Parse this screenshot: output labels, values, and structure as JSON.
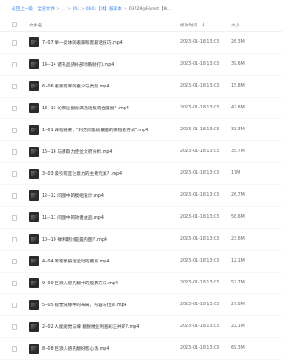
{
  "breadcrumb": {
    "back": "返回上一级",
    "all": "全部文件",
    "l2": "...",
    "l3": "IPL",
    "l4": "0601【木】股家本",
    "current": "03729@Forest【Ki..."
  },
  "header": {
    "name": "文件名",
    "time": "修改时间",
    "size": "大小"
  },
  "files": [
    {
      "name": "7--07 举一反体的邀家和客服话技巧.mp4",
      "time": "2023-01-18 13:03",
      "size": "26.3M"
    },
    {
      "name": "14--14 诺礼品货补部领胸接打).mp4",
      "time": "2023-01-18 13:03",
      "size": "39.6M"
    },
    {
      "name": "6--06 邀家阿库的重义与类则.mp4",
      "time": "2023-01-18 13:03",
      "size": "15.8M"
    },
    {
      "name": "13--13 论明让额会满通话贩流合度展? .mp4",
      "time": "2023-01-18 13:03",
      "size": "42.8M"
    },
    {
      "name": "1--01 课程概要：\"利范问题段最值的照短看方式\".mp4",
      "time": "2023-01-18 13:03",
      "size": "33.3M"
    },
    {
      "name": "16--16 与质取力佳位文府分析.mp4",
      "time": "2023-01-18 13:03",
      "size": "35.7M"
    },
    {
      "name": "3--03 吸引较宜注意力的主要元素? .mp4",
      "time": "2023-01-18 13:03",
      "size": "17M"
    },
    {
      "name": "12--12 问图中的模组设计.mp4",
      "time": "2023-01-18 13:03",
      "size": "26.7M"
    },
    {
      "name": "11--11 问图中的效者益品.mp4",
      "time": "2023-01-18 13:03",
      "size": "58.6M"
    },
    {
      "name": "10--10 禅利期讨是是内图? .mp4",
      "time": "2023-01-18 13:03",
      "size": "23.6M"
    },
    {
      "name": "4--04 传客修按浪运动的要点.mp4",
      "time": "2023-01-18 13:03",
      "size": "12.1M"
    },
    {
      "name": "9--09 巨浪人感先翻中的股票方法.mp4",
      "time": "2023-01-18 13:03",
      "size": "52.7M"
    },
    {
      "name": "5--05 视觉说缘中的布局、内容与位的.mp4",
      "time": "2023-01-18 13:03",
      "size": "27.8M"
    },
    {
      "name": "2--02 人能视觉法律 翻脱楼业利国彩正并的?.mp4",
      "time": "2023-01-18 13:03",
      "size": "22.1M"
    },
    {
      "name": "8--08 巨浪人感先翻好客心场.mp4",
      "time": "2023-01-18 13:03",
      "size": "69.3M"
    }
  ]
}
